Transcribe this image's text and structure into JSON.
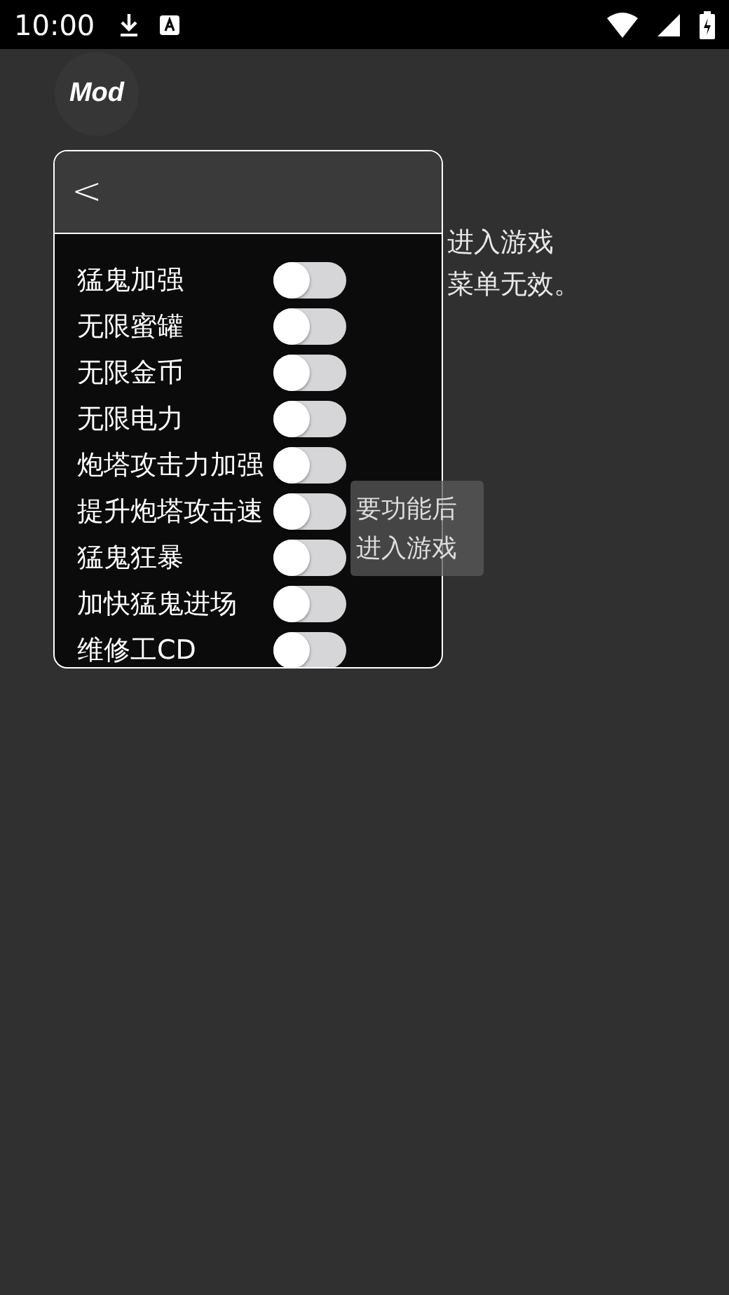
{
  "status_bar": {
    "time": "10:00"
  },
  "logo": {
    "label": "Mod"
  },
  "background_text": [
    "进入游戏",
    "菜单无效。"
  ],
  "toast": [
    "要功能后",
    "进入游戏"
  ],
  "menu": {
    "back": "<",
    "items": [
      {
        "label": "猛鬼加强",
        "on": false
      },
      {
        "label": "无限蜜罐",
        "on": false
      },
      {
        "label": "无限金币",
        "on": false
      },
      {
        "label": "无限电力",
        "on": false
      },
      {
        "label": "炮塔攻击力加强",
        "on": false
      },
      {
        "label": "提升炮塔攻击速",
        "on": false
      },
      {
        "label": "猛鬼狂暴",
        "on": false
      },
      {
        "label": "加快猛鬼进场",
        "on": false
      },
      {
        "label": "维修工CD",
        "on": false
      }
    ]
  }
}
